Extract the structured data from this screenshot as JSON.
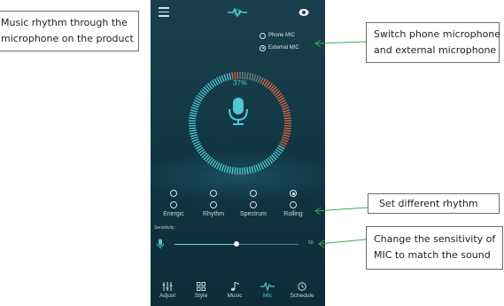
{
  "callouts": {
    "left": {
      "line1": "Music rhythm through the",
      "line2": "microphone on the product"
    },
    "switch": {
      "line1": "Switch phone microphone",
      "line2": "and external microphone"
    },
    "rhythm": {
      "line1": "Set different rhythm"
    },
    "sensitivity": {
      "line1": "Change the sensitivity of",
      "line2": "MIC to match the sound"
    }
  },
  "app": {
    "mic_source": {
      "options": [
        {
          "label": "Phone MIC",
          "selected": false
        },
        {
          "label": "External MIC",
          "selected": true
        }
      ]
    },
    "level_percent": "37%",
    "rhythms": [
      {
        "label": "Energic",
        "selected": false
      },
      {
        "label": "Rhythm",
        "selected": false
      },
      {
        "label": "Spectrum",
        "selected": false
      },
      {
        "label": "Rolling",
        "selected": true
      }
    ],
    "sensitivity": {
      "label": "Sensitivity:",
      "value": "50",
      "fraction": 0.5
    },
    "tabs": [
      {
        "label": "Adjust",
        "icon": "sliders-icon",
        "active": false
      },
      {
        "label": "Style",
        "icon": "grid-icon",
        "active": false
      },
      {
        "label": "Music",
        "icon": "music-note-icon",
        "active": false
      },
      {
        "label": "Mic",
        "icon": "waveform-icon",
        "active": true
      },
      {
        "label": "Schedule",
        "icon": "clock-icon",
        "active": false
      }
    ]
  },
  "colors": {
    "accent": "#4fc9cf",
    "ring_warm": "#e0663f",
    "arrow": "#3aaa57",
    "phone_bg": "#133a46"
  }
}
